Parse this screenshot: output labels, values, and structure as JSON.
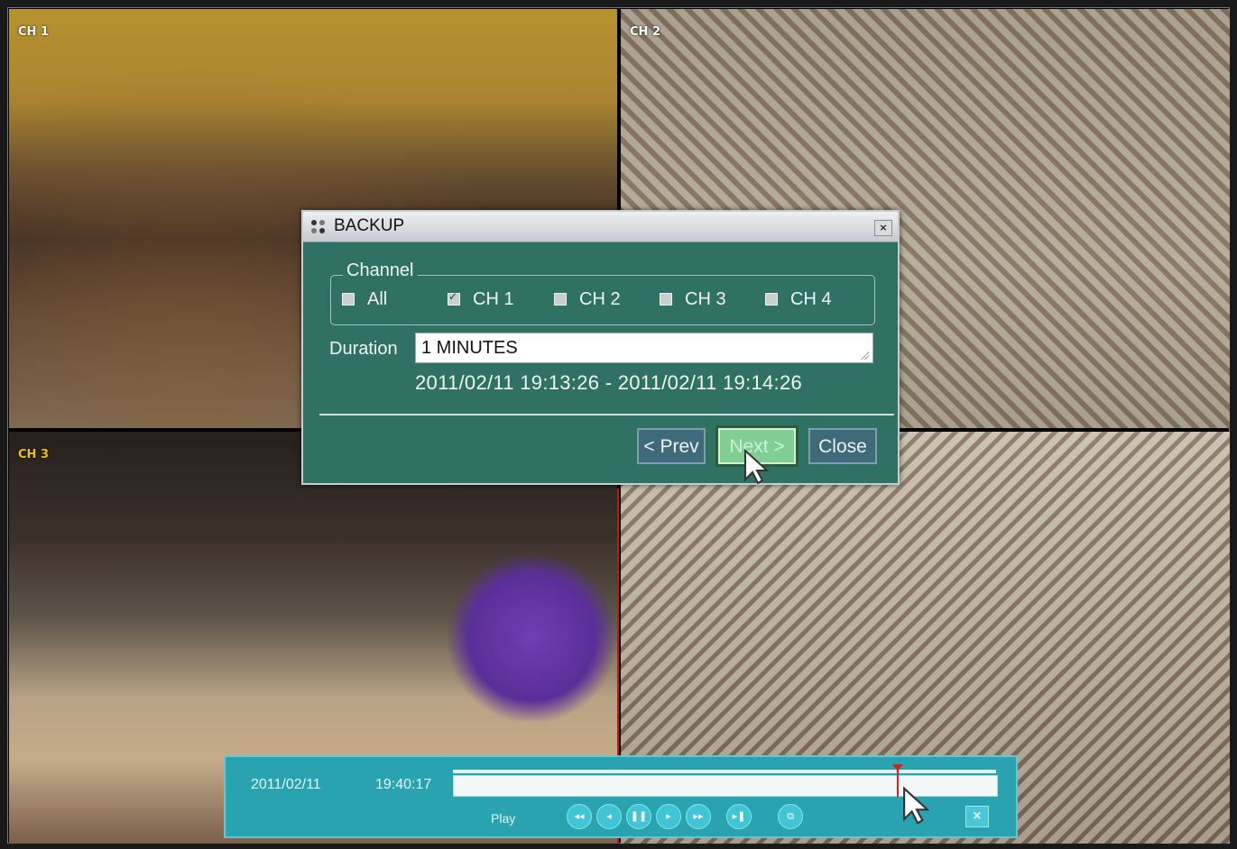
{
  "channels": [
    {
      "label": "CH 1"
    },
    {
      "label": "CH 2"
    },
    {
      "label": "CH 3"
    },
    {
      "label": ""
    }
  ],
  "dialog": {
    "title": "BACKUP",
    "close_glyph": "×",
    "channel_group": {
      "legend": "Channel",
      "options": [
        {
          "label": "All",
          "checked": false
        },
        {
          "label": "CH 1",
          "checked": true
        },
        {
          "label": "CH 2",
          "checked": false
        },
        {
          "label": "CH 3",
          "checked": false
        },
        {
          "label": "CH 4",
          "checked": false
        }
      ]
    },
    "duration": {
      "label": "Duration",
      "value": "1 MINUTES"
    },
    "time_range": "2011/02/11 19:13:26 - 2011/02/11 19:14:26",
    "buttons": {
      "prev": "< Prev",
      "next": "Next >",
      "close": "Close"
    }
  },
  "playback": {
    "date": "2011/02/11",
    "time": "19:40:17",
    "mode": "Play",
    "position_fraction": 0.82,
    "controls": [
      {
        "name": "fast-rewind-icon",
        "glyph": "◂◂"
      },
      {
        "name": "step-back-icon",
        "glyph": "◂"
      },
      {
        "name": "pause-icon",
        "glyph": "❚❚"
      },
      {
        "name": "play-icon",
        "glyph": "▸"
      },
      {
        "name": "fast-forward-icon",
        "glyph": "▸▸"
      },
      {
        "name": "step-forward-icon",
        "glyph": "▸❚"
      },
      {
        "name": "backup-icon",
        "glyph": "⧉"
      }
    ],
    "close_glyph": "×"
  },
  "colors": {
    "dialog_bg": "#2f7162",
    "playback_bg": "#2aa3b0",
    "recording_marker": "#d82020",
    "ch3_label": "#f2c200"
  }
}
